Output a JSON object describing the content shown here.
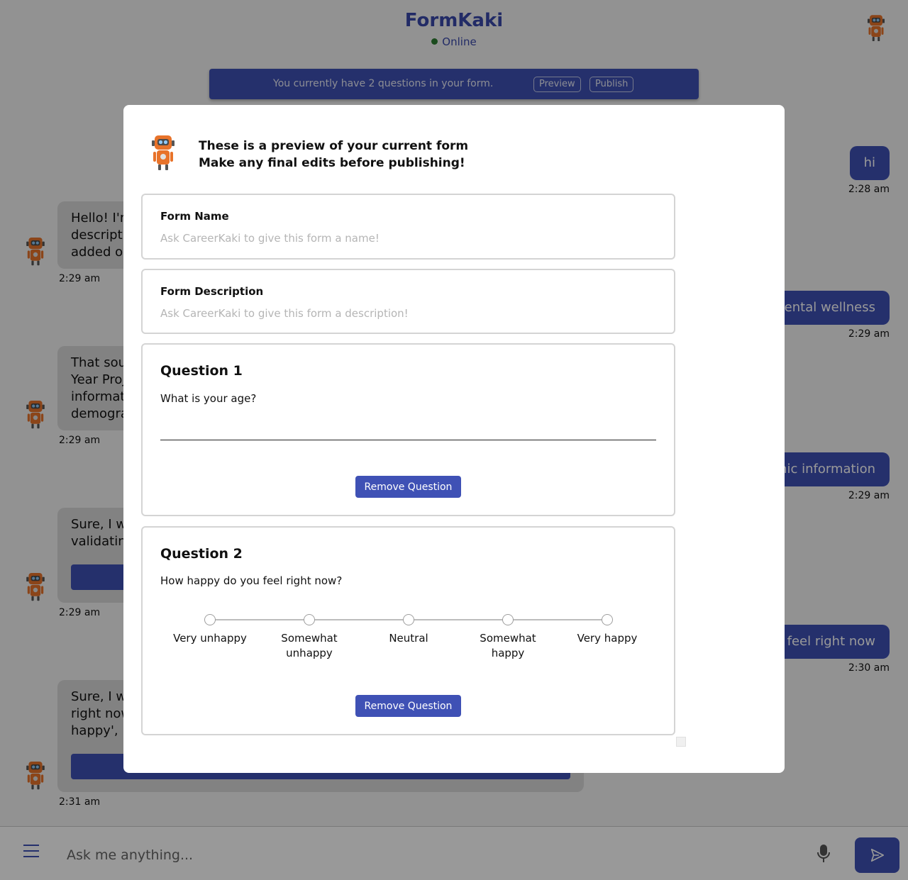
{
  "app": {
    "title": "FormKaki",
    "status": "Online"
  },
  "banner": {
    "text": "You currently have 2 questions in your form.",
    "preview_label": "Preview",
    "publish_label": "Publish"
  },
  "chat": {
    "user_messages": [
      {
        "text": "hi",
        "time": "2:28 am"
      },
      {
        "text": "mental wellness",
        "time": "2:29 am"
      },
      {
        "text": "phic information",
        "time": "2:29 am"
      },
      {
        "text": "ey feel right now",
        "time": "2:30 am"
      }
    ],
    "bot_messages": [
      {
        "lines": [
          "Hello! I'm",
          "descriptio",
          "added on"
        ],
        "time": "2:29 am"
      },
      {
        "lines": [
          "That sour",
          "Year Proje",
          "informati",
          "demograp"
        ],
        "time": "2:29 am"
      },
      {
        "lines": [
          "Sure, I wi",
          "validating"
        ],
        "time": "2:29 am"
      },
      {
        "lines": [
          "Sure, I wi",
          "right now",
          "happy', 'V"
        ],
        "time": "2:31 am"
      }
    ]
  },
  "footer": {
    "input_placeholder": "Ask me anything..."
  },
  "modal": {
    "heading_line1": "These is a preview of your current form",
    "heading_line2": "Make any final edits before publishing!",
    "form_name": {
      "label": "Form Name",
      "placeholder": "Ask CareerKaki to give this form a name!"
    },
    "form_description": {
      "label": "Form Description",
      "placeholder": "Ask CareerKaki to give this form a description!"
    },
    "questions": [
      {
        "title": "Question 1",
        "text": "What is your age?",
        "remove_label": "Remove Question"
      },
      {
        "title": "Question 2",
        "text": "How happy do you feel right now?",
        "scale": [
          "Very unhappy",
          "Somewhat unhappy",
          "Neutral",
          "Somewhat happy",
          "Very happy"
        ],
        "remove_label": "Remove Question"
      }
    ]
  },
  "colors": {
    "accent": "#3f51b5",
    "status_dot": "#2e7d32",
    "robot_orange": "#e8732a"
  }
}
